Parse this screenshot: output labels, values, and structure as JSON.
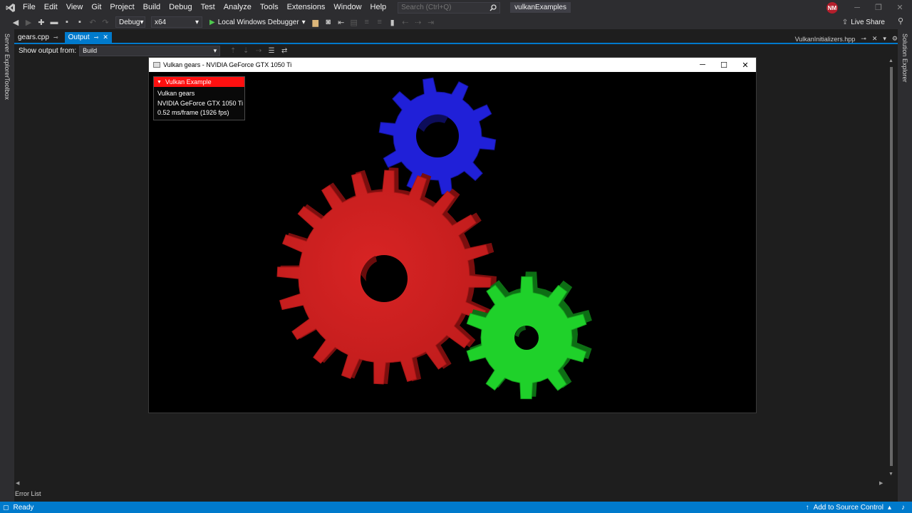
{
  "menubar": {
    "items": [
      "File",
      "Edit",
      "View",
      "Git",
      "Project",
      "Build",
      "Debug",
      "Test",
      "Analyze",
      "Tools",
      "Extensions",
      "Window",
      "Help"
    ],
    "search_placeholder": "Search (Ctrl+Q)",
    "solution_name": "vulkanExamples",
    "user_initials": "NM"
  },
  "toolbar": {
    "config": "Debug",
    "platform": "x64",
    "debugger": "Local Windows Debugger",
    "live_share": "Live Share"
  },
  "rails": {
    "left": [
      "Server Explorer",
      "Toolbox"
    ],
    "right": [
      "Solution Explorer"
    ]
  },
  "tabs": {
    "items": [
      {
        "label": "gears.cpp",
        "active": false
      },
      {
        "label": "Output",
        "active": true
      }
    ],
    "right_file": "VulkanInitializers.hpp"
  },
  "output": {
    "show_from_label": "Show output from:",
    "source": "Build"
  },
  "app_window": {
    "title": "Vulkan gears - NVIDIA GeForce GTX 1050 Ti",
    "overlay": {
      "header": "Vulkan Example",
      "lines": [
        "Vulkan gears",
        "NVIDIA GeForce GTX 1050 Ti",
        "0.52 ms/frame (1926 fps)"
      ]
    },
    "gear_colors": {
      "red": "#d42020",
      "green": "#1fd12a",
      "blue": "#2020d8"
    }
  },
  "bottom_tabs": {
    "error_list": "Error List"
  },
  "statusbar": {
    "status": "Ready",
    "source_control": "Add to Source Control"
  },
  "colors": {
    "accent": "#007acc",
    "overlay_header": "#ff1010"
  }
}
